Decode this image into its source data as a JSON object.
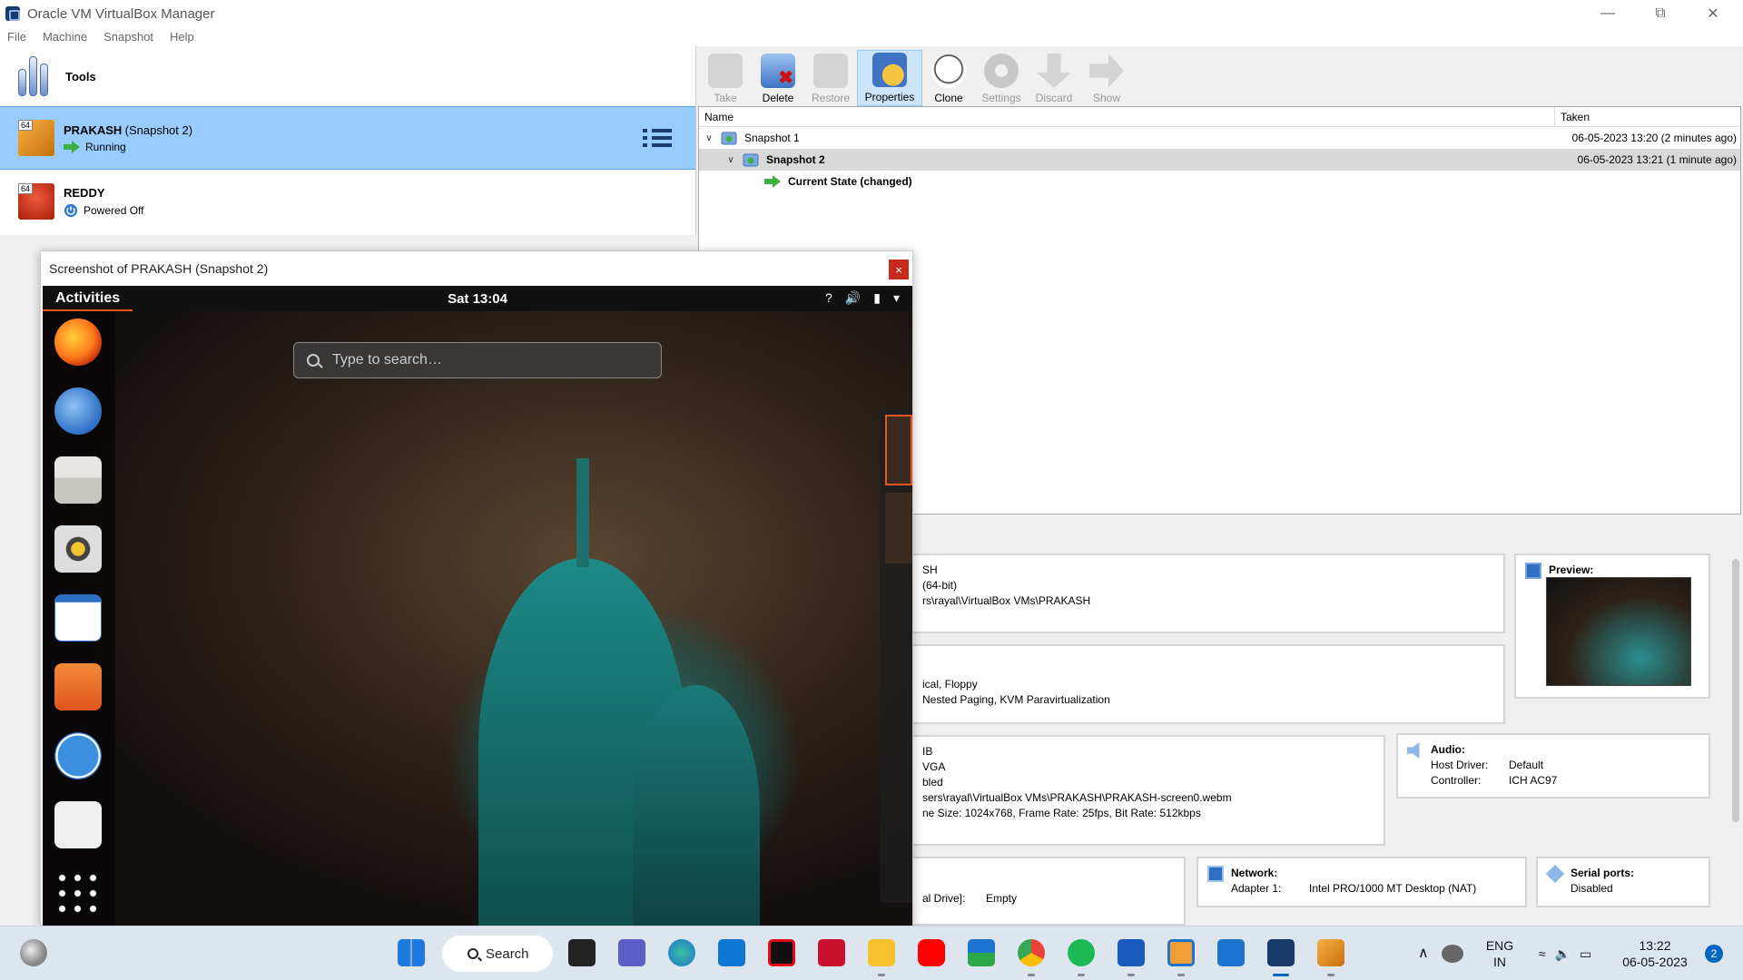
{
  "window": {
    "title": "Oracle VM VirtualBox Manager"
  },
  "menu": [
    "File",
    "Machine",
    "Snapshot",
    "Help"
  ],
  "tools": {
    "label": "Tools"
  },
  "vms": [
    {
      "name": "PRAKASH",
      "snapshot": "(Snapshot 2)",
      "status": "Running",
      "badge": "64",
      "color": "#e8a020"
    },
    {
      "name": "REDDY",
      "snapshot": "",
      "status": "Powered Off",
      "badge": "64",
      "color": "#d83a1e"
    }
  ],
  "toolbar": {
    "take": "Take",
    "delete": "Delete",
    "restore": "Restore",
    "properties": "Properties",
    "clone": "Clone",
    "settings": "Settings",
    "discard": "Discard",
    "show": "Show"
  },
  "snapshots": {
    "col_name": "Name",
    "col_taken": "Taken",
    "rows": [
      {
        "name": "Snapshot 1",
        "taken": "06-05-2023 13:20 (2 minutes ago)"
      },
      {
        "name": "Snapshot 2",
        "taken": "06-05-2023 13:21 (1 minute ago)"
      },
      {
        "name": "Current State (changed)",
        "taken": ""
      }
    ]
  },
  "details": {
    "general": [
      "SH",
      " (64-bit)",
      "rs\\rayal\\VirtualBox VMs\\PRAKASH"
    ],
    "system": [
      "ical, Floppy",
      "Nested Paging, KVM Paravirtualization"
    ],
    "display": [
      "IB",
      "VGA",
      "bled",
      "sers\\rayal\\VirtualBox VMs\\PRAKASH\\PRAKASH-screen0.webm",
      "ne Size: 1024x768, Frame Rate: 25fps, Bit Rate: 512kbps"
    ],
    "storage": {
      "line": "al Drive]:",
      "value": "Empty"
    },
    "preview": {
      "title": "Preview:"
    },
    "audio": {
      "title": "Audio:",
      "host_driver_label": "Host Driver:",
      "host_driver": "Default",
      "controller_label": "Controller:",
      "controller": "ICH AC97"
    },
    "network": {
      "title": "Network:",
      "adapter_label": "Adapter 1:",
      "adapter": "Intel PRO/1000 MT Desktop (NAT)"
    },
    "serial": {
      "title": "Serial ports:",
      "value": "Disabled"
    }
  },
  "screenshot_window": {
    "title": "Screenshot of PRAKASH (Snapshot 2)",
    "close": "×",
    "guest": {
      "activities": "Activities",
      "clock": "Sat 13:04",
      "search_placeholder": "Type to search…",
      "tray": [
        "?",
        "🔊",
        "▮",
        "▾"
      ]
    }
  },
  "taskbar": {
    "search": "Search",
    "lang": "ENG",
    "region": "IN",
    "time": "13:22",
    "date": "06-05-2023",
    "notifications": "2"
  }
}
